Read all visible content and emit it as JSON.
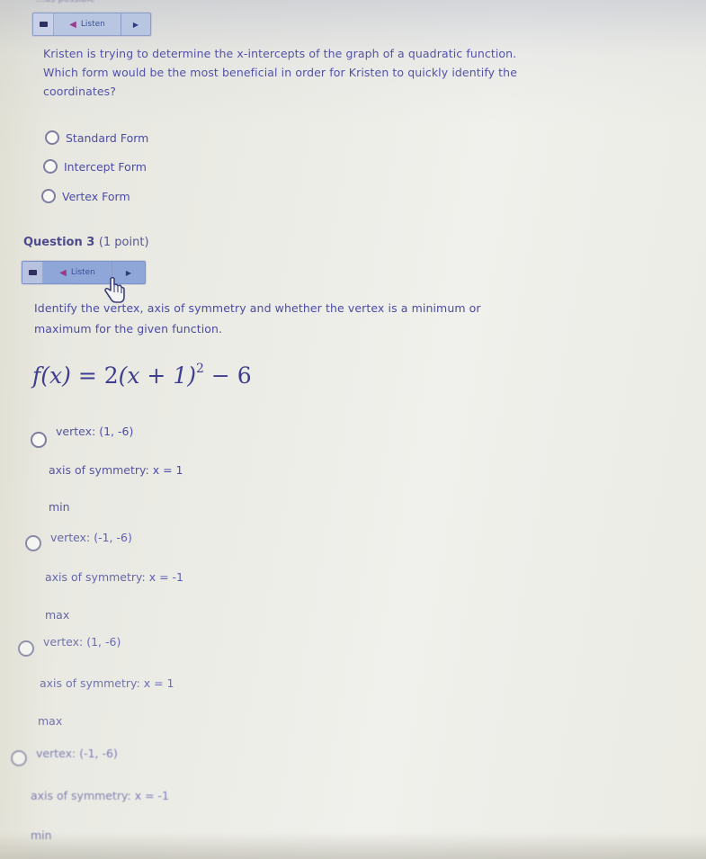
{
  "top_cutoff_text": "…as possible",
  "question_2": {
    "listen_bar": {
      "settings_icon": "keyboard-icon",
      "speaker_icon": "speaker-icon",
      "listen_label": "Listen",
      "play_icon": "play-icon"
    },
    "prompt_line_1": "Kristen is trying to determine the x-intercepts of the graph of a quadratic function.",
    "prompt_line_2": "Which form would be the most beneficial in order for Kristen to quickly identify the",
    "prompt_line_3": "coordinates?",
    "options": [
      {
        "label": "Standard Form",
        "selected": false
      },
      {
        "label": "Intercept Form",
        "selected": false
      },
      {
        "label": "Vertex Form",
        "selected": false
      }
    ]
  },
  "question_3": {
    "heading": "Question 3",
    "points": "(1 point)",
    "listen_bar": {
      "settings_icon": "keyboard-icon",
      "speaker_icon": "speaker-icon",
      "listen_label": "Listen",
      "play_icon": "play-icon",
      "state": "hover"
    },
    "prompt_line_1": "Identify the vertex, axis of symmetry and whether the vertex is a minimum or",
    "prompt_line_2": "maximum for the given function.",
    "formula": {
      "lhs": "f(x)",
      "equals": "=",
      "coef": "2",
      "inner": "(x + 1)",
      "exponent": "2",
      "tail": "− 6"
    },
    "options": [
      {
        "vertex_label": "vertex:",
        "vertex_value": "(1, -6)",
        "axis_label": "axis of symmetry:",
        "axis_value": "x = 1",
        "extremum": "min",
        "selected": false
      },
      {
        "vertex_label": "vertex:",
        "vertex_value": "(-1, -6)",
        "axis_label": "axis of symmetry:",
        "axis_value": "x = -1",
        "extremum": "max",
        "selected": false
      },
      {
        "vertex_label": "vertex:",
        "vertex_value": "(1, -6)",
        "axis_label": "axis of symmetry:",
        "axis_value": "x = 1",
        "extremum": "max",
        "selected": false
      },
      {
        "vertex_label": "vertex:",
        "vertex_value": "(-1, -6)",
        "axis_label": "axis of symmetry:",
        "axis_value": "x = -1",
        "extremum": "min",
        "selected": false
      }
    ]
  },
  "colors": {
    "text": "#4b4aa6",
    "listen_bar": "#b9c6e2",
    "listen_bar_hover": "#8fa6d8",
    "speaker": "#9a3a8a"
  }
}
